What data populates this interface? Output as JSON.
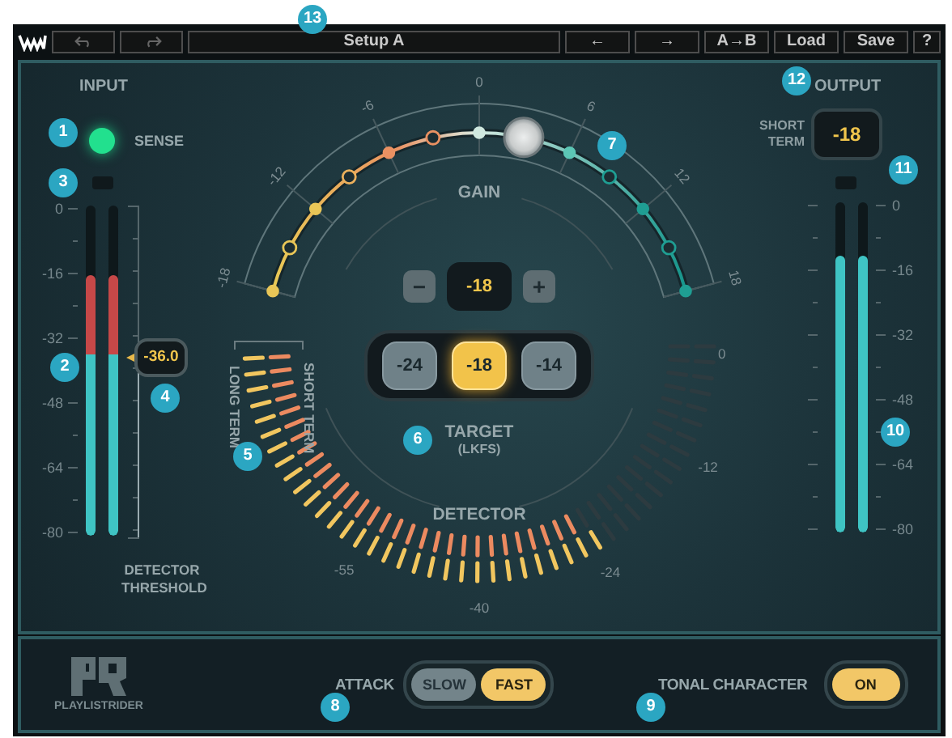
{
  "toolbar": {
    "preset": "Setup A",
    "buttons": [
      "←",
      "→",
      "A→B",
      "Load",
      "Save",
      "?"
    ]
  },
  "input": {
    "title": "INPUT",
    "sense_label": "SENSE",
    "sense_on": true,
    "scale": [
      "0",
      "-16",
      "-32",
      "-48",
      "-64",
      "-80"
    ],
    "meters": [
      {
        "level": 0.79
      },
      {
        "level": 0.79
      }
    ],
    "threshold": {
      "value": "-36.0",
      "level": 0.55,
      "label": "DETECTOR THRESHOLD"
    }
  },
  "gain": {
    "title": "GAIN",
    "scale": [
      "-18",
      "-12",
      "-6",
      "0",
      "6",
      "12",
      "18"
    ],
    "level": 0.58
  },
  "target": {
    "minus": "−",
    "value": "-18",
    "plus": "+",
    "presets": [
      {
        "label": "-24",
        "selected": false
      },
      {
        "label": "-18",
        "selected": true
      },
      {
        "label": "-14",
        "selected": false
      }
    ],
    "title": "TARGET",
    "unit": "(LKFS)"
  },
  "detector": {
    "title": "DETECTOR",
    "long_term": {
      "label": "LONG TERM",
      "level": 0.76
    },
    "short_term": {
      "label": "SHORT TERM",
      "level": 0.75
    },
    "scale": [
      "-55",
      "-40",
      "-24",
      "-12",
      "0"
    ]
  },
  "output": {
    "title": "OUTPUT",
    "short_term_label": "SHORT TERM",
    "value": "-18",
    "scale": [
      "0",
      "-16",
      "-32",
      "-48",
      "-64",
      "-80"
    ],
    "meters": [
      {
        "level": 0.84
      },
      {
        "level": 0.84
      }
    ]
  },
  "bottom": {
    "logo_text": "PLAYLISTRIDER",
    "attack": {
      "label": "ATTACK",
      "options": [
        {
          "label": "SLOW",
          "selected": false
        },
        {
          "label": "FAST",
          "selected": true
        }
      ]
    },
    "tonal_character": {
      "label": "TONAL CHARACTER",
      "button": "ON",
      "on": true
    }
  },
  "callouts": [
    "13",
    "12",
    "1",
    "7",
    "11",
    "3",
    "2",
    "4",
    "10",
    "6",
    "5",
    "8",
    "9"
  ]
}
